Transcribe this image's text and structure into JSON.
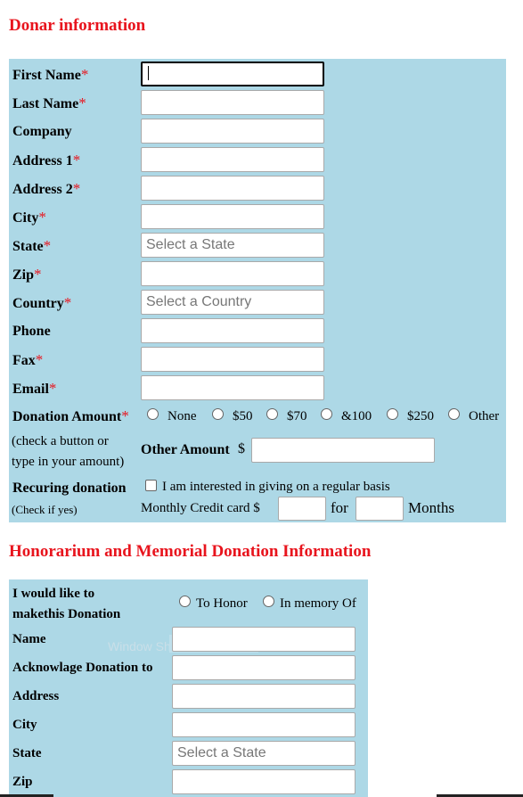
{
  "donor": {
    "heading": "Donar information",
    "fields": [
      {
        "label": "First Name",
        "required": true,
        "placeholder": ""
      },
      {
        "label": "Last Name",
        "required": true,
        "placeholder": ""
      },
      {
        "label": "Company",
        "required": false,
        "placeholder": ""
      },
      {
        "label": "Address 1",
        "required": true,
        "placeholder": ""
      },
      {
        "label": "Address 2",
        "required": true,
        "placeholder": ""
      },
      {
        "label": "City",
        "required": true,
        "placeholder": ""
      },
      {
        "label": "State",
        "required": true,
        "placeholder": "Select a State"
      },
      {
        "label": "Zip",
        "required": true,
        "placeholder": ""
      },
      {
        "label": "Country",
        "required": true,
        "placeholder": "Select a Country"
      },
      {
        "label": "Phone",
        "required": false,
        "placeholder": ""
      },
      {
        "label": "Fax",
        "required": true,
        "placeholder": ""
      },
      {
        "label": "Email",
        "required": true,
        "placeholder": ""
      }
    ],
    "required_mark": "*",
    "donation_amount": {
      "label": "Donation Amount",
      "options": [
        "None",
        "$50",
        "$70",
        "&100",
        "$250",
        "Other"
      ],
      "hint_line1": "(check a button or",
      "hint_line2": "type in your amount)",
      "other_label": "Other Amount",
      "currency": "$"
    },
    "recurring": {
      "label": "Recuring donation",
      "hint": "(Check if yes)",
      "checkbox_label": "I am interested in giving on a regular basis",
      "monthly_label": "Monthly Credit card $",
      "for_label": "for",
      "months_label": "Months"
    }
  },
  "honor": {
    "heading": "Honorarium and Memorial Donation Information",
    "would_like_line1": "I would like to",
    "would_like_line2": "makethis Donation",
    "options": [
      "To Honor",
      "In memory Of"
    ],
    "fields": [
      {
        "label": "Name",
        "placeholder": ""
      },
      {
        "label": "Acknowlage Donation to",
        "placeholder": ""
      },
      {
        "label": "Address",
        "placeholder": ""
      },
      {
        "label": "City",
        "placeholder": ""
      },
      {
        "label": "State",
        "placeholder": "Select a State"
      },
      {
        "label": "Zip",
        "placeholder": ""
      }
    ],
    "watermark": "Window Sh"
  }
}
